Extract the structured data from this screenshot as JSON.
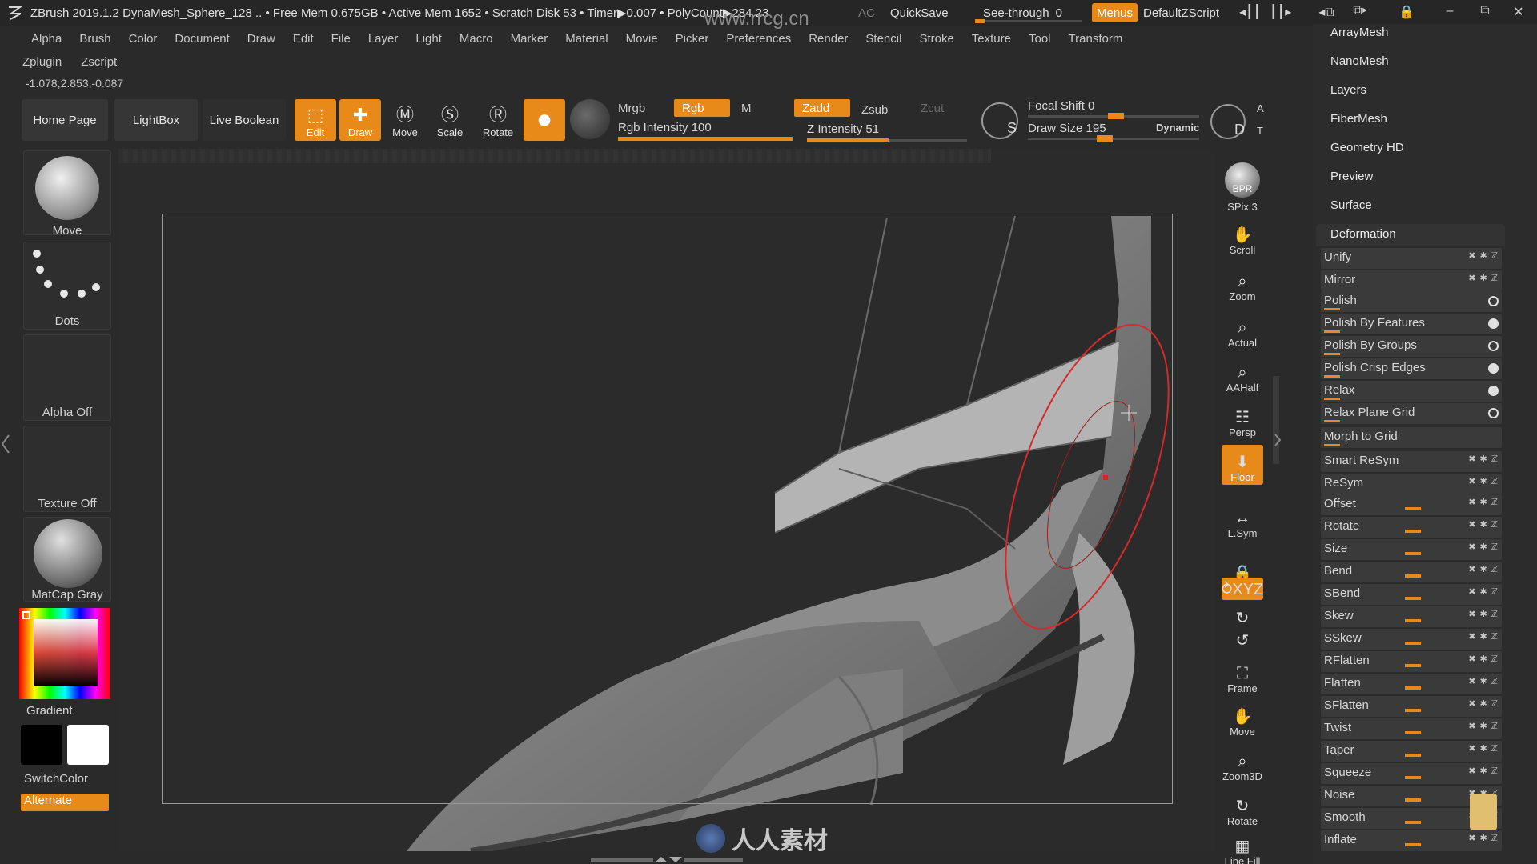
{
  "titlebar": {
    "app_title": "ZBrush 2019.1.2   DynaMesh_Sphere_128   .. • Free Mem 0.675GB • Active Mem 1652 • Scratch Disk 53 •  Timer▶0.007 • PolyCount▶284.23",
    "ac": "AC",
    "quicksave": "QuickSave",
    "seethrough_label": "See-through",
    "seethrough_value": "0",
    "menus": "Menus",
    "defaultzscript": "DefaultZScript"
  },
  "site_watermark": "www.rrcg.cn",
  "menu": [
    "Alpha",
    "Brush",
    "Color",
    "Document",
    "Draw",
    "Edit",
    "File",
    "Layer",
    "Light",
    "Macro",
    "Marker",
    "Material",
    "Movie",
    "Picker",
    "Preferences",
    "Render",
    "Stencil",
    "Stroke",
    "Texture",
    "Tool",
    "Transform"
  ],
  "menu2": [
    "Zplugin",
    "Zscript"
  ],
  "coords": "-1.078,2.853,-0.087",
  "shelf": {
    "home_page": "Home Page",
    "lightbox": "LightBox",
    "live_boolean": "Live Boolean",
    "edit": "Edit",
    "draw": "Draw",
    "move": "Move",
    "scale": "Scale",
    "rotate": "Rotate",
    "mrgb": "Mrgb",
    "rgb": "Rgb",
    "m": "M",
    "zadd": "Zadd",
    "zsub": "Zsub",
    "zcut": "Zcut",
    "rgb_intensity_label": "Rgb Intensity 100",
    "rgb_intensity": 100,
    "z_intensity_label": "Z Intensity 51",
    "z_intensity": 51,
    "focal_shift_label": "Focal Shift 0",
    "focal_shift": 0,
    "draw_size_label": "Draw Size 195",
    "draw_size": 195,
    "dynamic": "Dynamic",
    "a": "A",
    "d": "D",
    "s": "S",
    "t": "T"
  },
  "left_panel": {
    "brush": "Move",
    "stroke": "Dots",
    "alpha": "Alpha Off",
    "texture": "Texture Off",
    "material": "MatCap Gray",
    "gradient": "Gradient",
    "switchcolor": "SwitchColor",
    "alternate": "Alternate"
  },
  "right_dock": [
    {
      "name": "bpr-button",
      "label": "SPix 3",
      "icon": "BPR",
      "on": false
    },
    {
      "name": "scroll-button",
      "label": "Scroll",
      "icon": "✋",
      "on": false
    },
    {
      "name": "zoom-button",
      "label": "Zoom",
      "icon": "⌕",
      "on": false
    },
    {
      "name": "actual-button",
      "label": "Actual",
      "icon": "⌕",
      "on": false
    },
    {
      "name": "aahalf-button",
      "label": "AAHalf",
      "icon": "⌕",
      "on": false
    },
    {
      "name": "persp-button",
      "label": "Persp",
      "icon": "☷",
      "on": false
    },
    {
      "name": "floor-button",
      "label": "Floor",
      "icon": "⬇",
      "on": true
    },
    {
      "name": "lsym-button",
      "label": "L.Sym",
      "icon": "↔",
      "on": false
    },
    {
      "name": "lock-button",
      "label": "",
      "icon": "🔒",
      "on": false
    },
    {
      "name": "xyz-button",
      "label": "",
      "icon": "⥁XYZ",
      "on": true
    },
    {
      "name": "rotate-y-button",
      "label": "",
      "icon": "↻",
      "on": false
    },
    {
      "name": "rotate-z-button",
      "label": "",
      "icon": "↺",
      "on": false
    },
    {
      "name": "frame-button",
      "label": "Frame",
      "icon": "⛶",
      "on": false
    },
    {
      "name": "move-view-button",
      "label": "Move",
      "icon": "✋",
      "on": false
    },
    {
      "name": "zoom3d-button",
      "label": "Zoom3D",
      "icon": "⌕",
      "on": false
    },
    {
      "name": "rotate-view-button",
      "label": "Rotate",
      "icon": "↻",
      "on": false
    },
    {
      "name": "linefill-button",
      "label": "Line Fill",
      "icon": "▦",
      "on": false
    }
  ],
  "tray": {
    "items": [
      "ArrayMesh",
      "NanoMesh",
      "Layers",
      "FiberMesh",
      "Geometry HD",
      "Preview",
      "Surface"
    ],
    "deformation_title": "Deformation",
    "rows": [
      {
        "label": "Unify",
        "kind": "axes",
        "value": null
      },
      {
        "label": "Mirror",
        "kind": "axes",
        "value": null
      },
      {
        "label": "Polish",
        "kind": "radio",
        "value": 0.05
      },
      {
        "label": "Polish By Features",
        "kind": "radio-filled",
        "value": 0.05
      },
      {
        "label": "Polish By Groups",
        "kind": "radio",
        "value": 0.05
      },
      {
        "label": "Polish Crisp Edges",
        "kind": "radio-filled",
        "value": 0.05
      },
      {
        "label": "Relax",
        "kind": "radio-filled",
        "value": 0.05
      },
      {
        "label": "Relax Plane Grid",
        "kind": "radio",
        "value": 0.05
      },
      {
        "label": "Morph to Grid",
        "kind": "none",
        "value": 0.05
      },
      {
        "label": "Smart ReSym",
        "kind": "axes",
        "value": null
      },
      {
        "label": "ReSym",
        "kind": "axes",
        "value": null
      },
      {
        "label": "Offset",
        "kind": "axes",
        "value": 0.5
      },
      {
        "label": "Rotate",
        "kind": "axes",
        "value": 0.5
      },
      {
        "label": "Size",
        "kind": "axes",
        "value": 0.5
      },
      {
        "label": "Bend",
        "kind": "axes",
        "value": 0.5
      },
      {
        "label": "SBend",
        "kind": "axes",
        "value": 0.5
      },
      {
        "label": "Skew",
        "kind": "axes",
        "value": 0.5
      },
      {
        "label": "SSkew",
        "kind": "axes",
        "value": 0.5
      },
      {
        "label": "RFlatten",
        "kind": "axes",
        "value": 0.5
      },
      {
        "label": "Flatten",
        "kind": "axes",
        "value": 0.5
      },
      {
        "label": "SFlatten",
        "kind": "axes",
        "value": 0.5
      },
      {
        "label": "Twist",
        "kind": "axes",
        "value": 0.5
      },
      {
        "label": "Taper",
        "kind": "axes",
        "value": 0.5
      },
      {
        "label": "Squeeze",
        "kind": "axes",
        "value": 0.5
      },
      {
        "label": "Noise",
        "kind": "axes",
        "value": 0.5
      },
      {
        "label": "Smooth",
        "kind": "axes",
        "value": 0.5
      },
      {
        "label": "Inflate",
        "kind": "axes",
        "value": 0.5
      }
    ]
  },
  "bottom_watermark": "人人素材",
  "colors": {
    "accent": "#e88a1a",
    "panel": "#2c2c2c",
    "button": "#363636"
  }
}
